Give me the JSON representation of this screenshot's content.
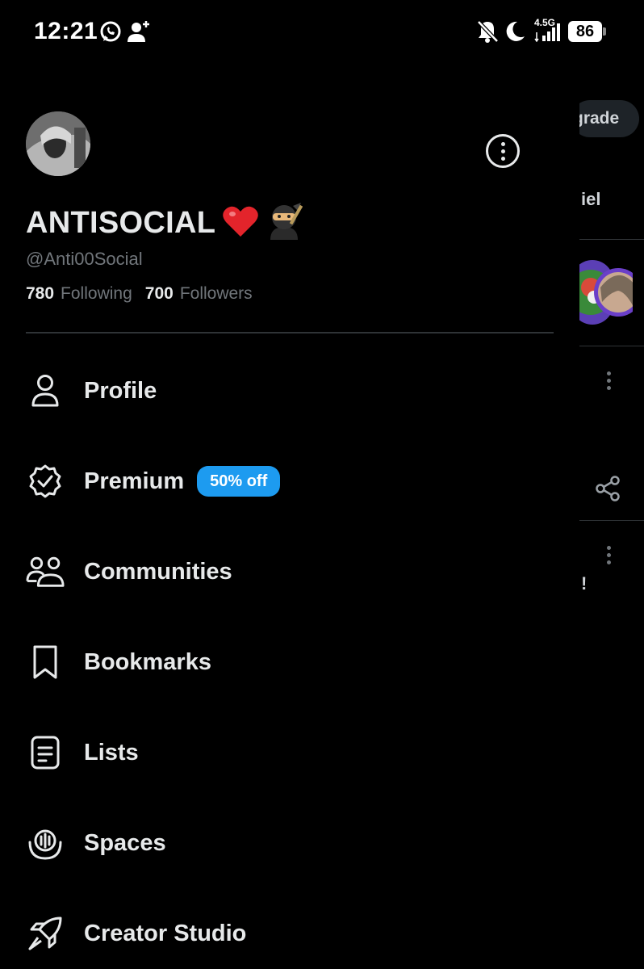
{
  "status_bar": {
    "time": "12:21",
    "network": "4.5G",
    "battery": "86"
  },
  "profile": {
    "display_name": "ANTISOCIAL",
    "name_emojis": "❤️🥷",
    "handle": "@Anti00Social",
    "following_count": "780",
    "following_label": "Following",
    "followers_count": "700",
    "followers_label": "Followers"
  },
  "menu": {
    "items": [
      {
        "label": "Profile",
        "icon": "person-icon"
      },
      {
        "label": "Premium",
        "icon": "verified-badge-icon",
        "badge": "50% off"
      },
      {
        "label": "Communities",
        "icon": "communities-icon"
      },
      {
        "label": "Bookmarks",
        "icon": "bookmark-icon"
      },
      {
        "label": "Lists",
        "icon": "lists-icon"
      },
      {
        "label": "Spaces",
        "icon": "spaces-icon"
      },
      {
        "label": "Creator Studio",
        "icon": "rocket-icon"
      }
    ]
  },
  "background_feed": {
    "upgrade_fragment": "grade",
    "name_fragment": "iel",
    "text_fragment": "!"
  },
  "colors": {
    "background": "#000000",
    "text_primary": "#e7e9ea",
    "text_secondary": "#71767b",
    "accent": "#1d9bf0",
    "divider": "#2f3336"
  }
}
